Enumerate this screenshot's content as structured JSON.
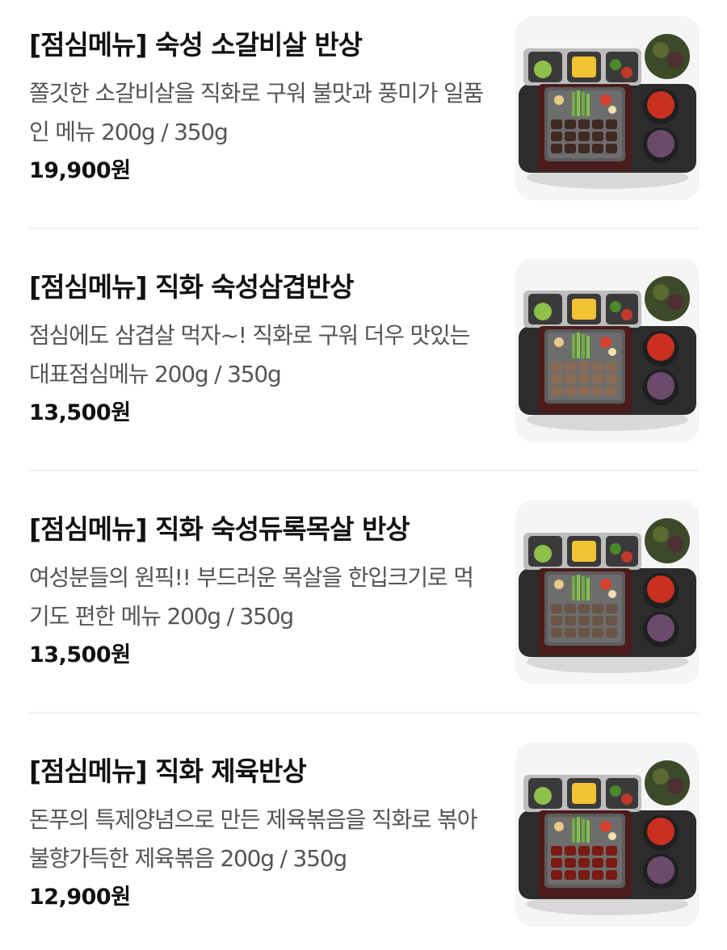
{
  "menu": {
    "items": [
      {
        "title": "[점심메뉴] 숙성 소갈비살 반상",
        "description": "쫄깃한 소갈비살을 직화로 구워 불맛과 풍미가 일품인 메뉴 200g / 350g",
        "price": "19,900원",
        "meat_color": "#3d2a22"
      },
      {
        "title": "[점심메뉴] 직화 숙성삼겹반상",
        "description": "점심에도 삼겹살 먹자~! 직화로 구워 더우 맛있는 대표점심메뉴 200g / 350g",
        "price": "13,500원",
        "meat_color": "#8a6a55"
      },
      {
        "title": "[점심메뉴] 직화 숙성듀록목살 반상",
        "description": "여성분들의 원픽!! 부드러운 목살을 한입크기로 먹기도 편한 메뉴 200g / 350g",
        "price": "13,500원",
        "meat_color": "#6a5446"
      },
      {
        "title": "[점심메뉴] 직화 제육반상",
        "description": "돈푸의 특제양념으로 만든 제육볶음을 직화로 볶아 불향가득한 제육볶음 200g / 350g",
        "price": "12,900원",
        "meat_color": "#7a1a12"
      }
    ]
  },
  "colors": {
    "thumb_bg": "#f5f5f5",
    "tray": "#2c2c2c",
    "divider": "#f0f0f0"
  }
}
